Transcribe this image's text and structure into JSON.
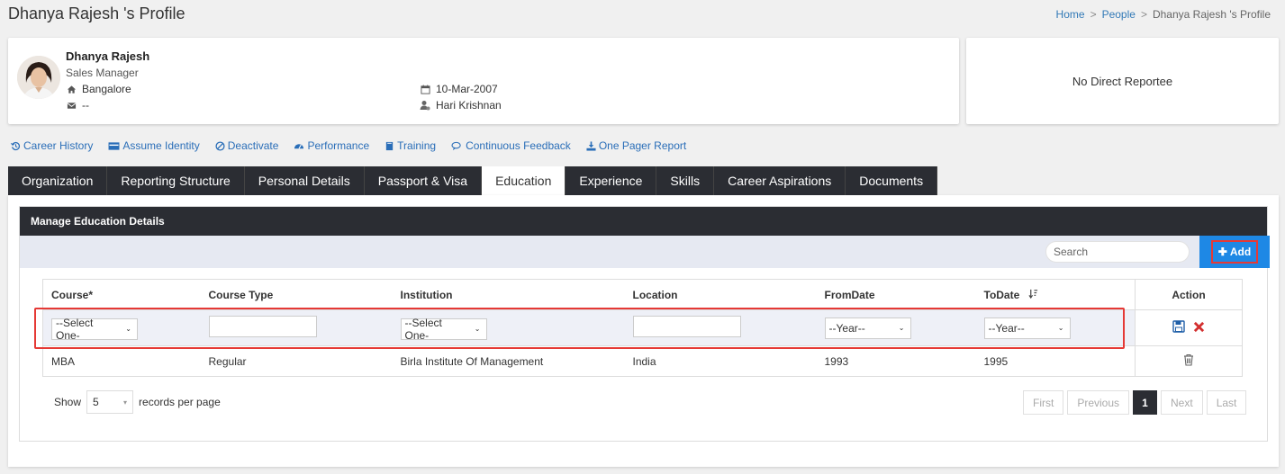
{
  "page": {
    "title": "Dhanya Rajesh 's Profile",
    "breadcrumb": [
      "Home",
      "People",
      "Dhanya Rajesh 's Profile"
    ],
    "breadcrumb_sep": ">"
  },
  "profile": {
    "name": "Dhanya Rajesh",
    "designation": "Sales Manager",
    "location": "Bangalore",
    "email": "--",
    "join_date": "10-Mar-2007",
    "manager": "Hari Krishnan"
  },
  "reportee": {
    "text": "No Direct Reportee"
  },
  "actions": [
    {
      "label": "Career History",
      "icon": "history-icon"
    },
    {
      "label": "Assume Identity",
      "icon": "id-card-icon"
    },
    {
      "label": "Deactivate",
      "icon": "ban-icon"
    },
    {
      "label": "Performance",
      "icon": "dashboard-icon"
    },
    {
      "label": "Training",
      "icon": "book-icon"
    },
    {
      "label": "Continuous Feedback",
      "icon": "chat-icon"
    },
    {
      "label": "One Pager Report",
      "icon": "download-icon"
    }
  ],
  "tabs": [
    "Organization",
    "Reporting Structure",
    "Personal Details",
    "Passport & Visa",
    "Education",
    "Experience",
    "Skills",
    "Career Aspirations",
    "Documents"
  ],
  "active_tab": "Education",
  "panel": {
    "title": "Manage Education Details",
    "search_placeholder": "Search",
    "add_label": "Add"
  },
  "table": {
    "headers": [
      "Course*",
      "Course Type",
      "Institution",
      "Location",
      "FromDate",
      "ToDate",
      "Action"
    ],
    "edit_row": {
      "course": "--Select One-",
      "course_type": "",
      "institution": "--Select One-",
      "location": "",
      "from": "--Year--",
      "to": "--Year--"
    },
    "rows": [
      [
        "MBA",
        "Regular",
        "Birla Institute Of Management",
        "India",
        "1993",
        "1995"
      ]
    ]
  },
  "footer": {
    "show_label": "Show",
    "page_size": "5",
    "records_label": "records per page",
    "pager": [
      "First",
      "Previous",
      "1",
      "Next",
      "Last"
    ],
    "current_page": "1"
  },
  "colors": {
    "accent": "#1e88e5",
    "dark": "#2b2d33",
    "highlight": "#e53935",
    "link": "#2a6eb8"
  }
}
